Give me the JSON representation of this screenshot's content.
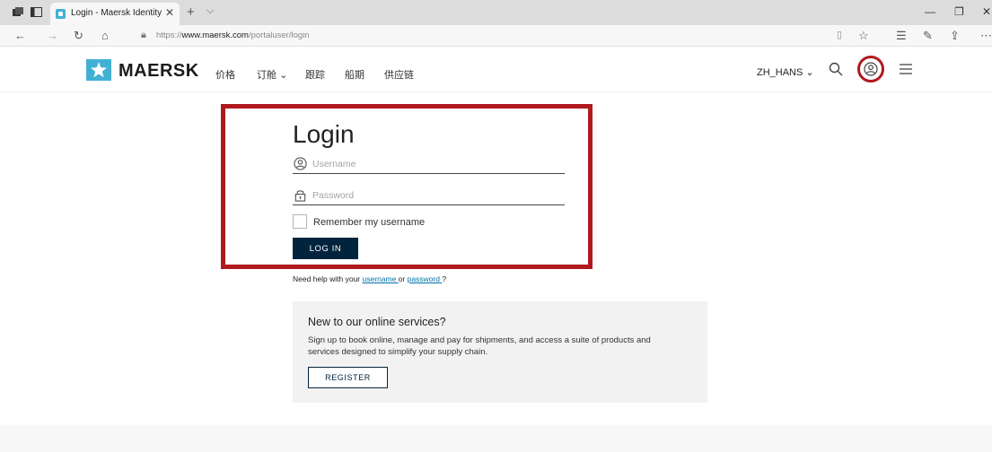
{
  "browser": {
    "tab_title": "Login - Maersk Identity",
    "tab_close": "✕",
    "new_tab": "+",
    "tab_menu": "⌵",
    "url_prefix": "https://",
    "url_domain": "www.maersk.com",
    "url_path": "/portaluser/login"
  },
  "header": {
    "logo_text": "MAERSK",
    "nav": [
      "价格",
      "订舱",
      "跟踪",
      "船期",
      "供应链"
    ],
    "language": "ZH_HANS"
  },
  "login": {
    "title": "Login",
    "username_placeholder": "Username",
    "password_placeholder": "Password",
    "remember_label": "Remember my username",
    "login_button": "LOG IN",
    "help_prefix": "Need help with your ",
    "help_username": "username ",
    "help_or": "or ",
    "help_password": "password ",
    "help_suffix": "?"
  },
  "register": {
    "title": "New to our online services?",
    "description": "Sign up to book online, manage and pay for shipments, and access a suite of products and services designed to simplify your supply chain.",
    "button": "REGISTER"
  },
  "colors": {
    "brand_blue": "#42b0d5",
    "button_navy": "#00243d",
    "highlight_red": "#b0191e",
    "link_blue": "#0073ab"
  }
}
